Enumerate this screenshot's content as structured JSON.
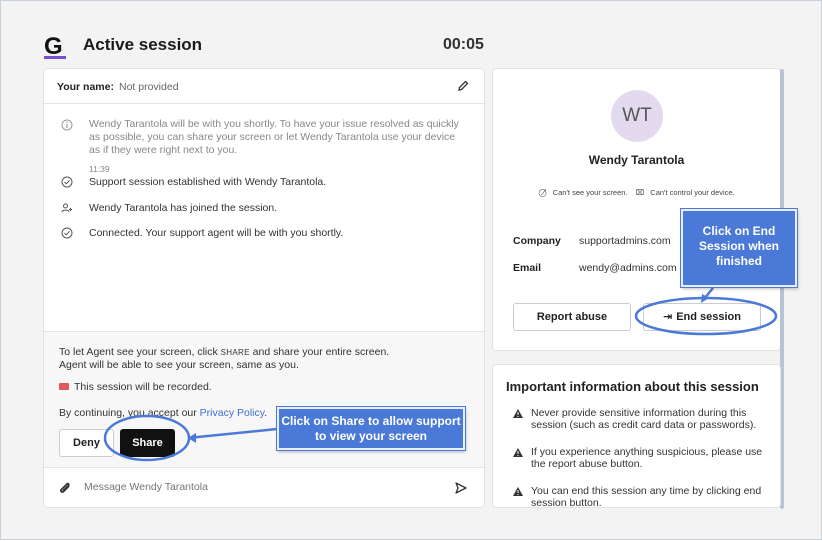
{
  "header": {
    "logo_icon": "g-logo-icon",
    "title": "Active session",
    "timer": "00:05"
  },
  "name_bar": {
    "label": "Your name:",
    "value": "Not provided",
    "edit_icon": "pencil-icon"
  },
  "chat": {
    "intro": "Wendy Tarantola will be with you shortly. To have your issue resolved as quickly as possible, you can share your screen or let Wendy Tarantola use your device as if they were right next to you.",
    "time": "11:39",
    "events": [
      "Support session established with Wendy Tarantola.",
      "Wendy Tarantola has joined the session.",
      "Connected. Your support agent will be with you shortly."
    ]
  },
  "share_panel": {
    "line1_pre": "To let Agent see your screen, click ",
    "line1_share": "SHARE",
    "line1_post": " and share your entire screen.",
    "line2": "Agent will be able to see your screen, same as you.",
    "recorded": "This session will be recorded.",
    "accept_pre": "By continuing, you accept our ",
    "accept_link": "Privacy Policy",
    "accept_post": ".",
    "deny_label": "Deny",
    "share_label": "Share"
  },
  "message_bar": {
    "placeholder": "Message Wendy Tarantola"
  },
  "agent": {
    "initials": "WT",
    "name": "Wendy Tarantola",
    "perm_screen": "Can't see your screen.",
    "perm_control": "Can't control your device.",
    "company_label": "Company",
    "company_value": "supportadmins.com",
    "email_label": "Email",
    "email_value": "wendy@admins.com",
    "report_label": "Report abuse",
    "end_label": "End session"
  },
  "info": {
    "title": "Important information about this session",
    "items": [
      "Never provide sensitive information during this session (such as credit card data or passwords).",
      "If you experience anything suspicious, please use the report abuse button.",
      "You can end this session any time by clicking end session button."
    ]
  },
  "callouts": {
    "share": "Click on Share to allow support to view your screen",
    "end": "Click on End Session when finished"
  },
  "colors": {
    "callout": "#4b79d8",
    "avatar_bg": "#e3daf0",
    "link": "#3b6fd6",
    "record": "#e05a5a"
  }
}
